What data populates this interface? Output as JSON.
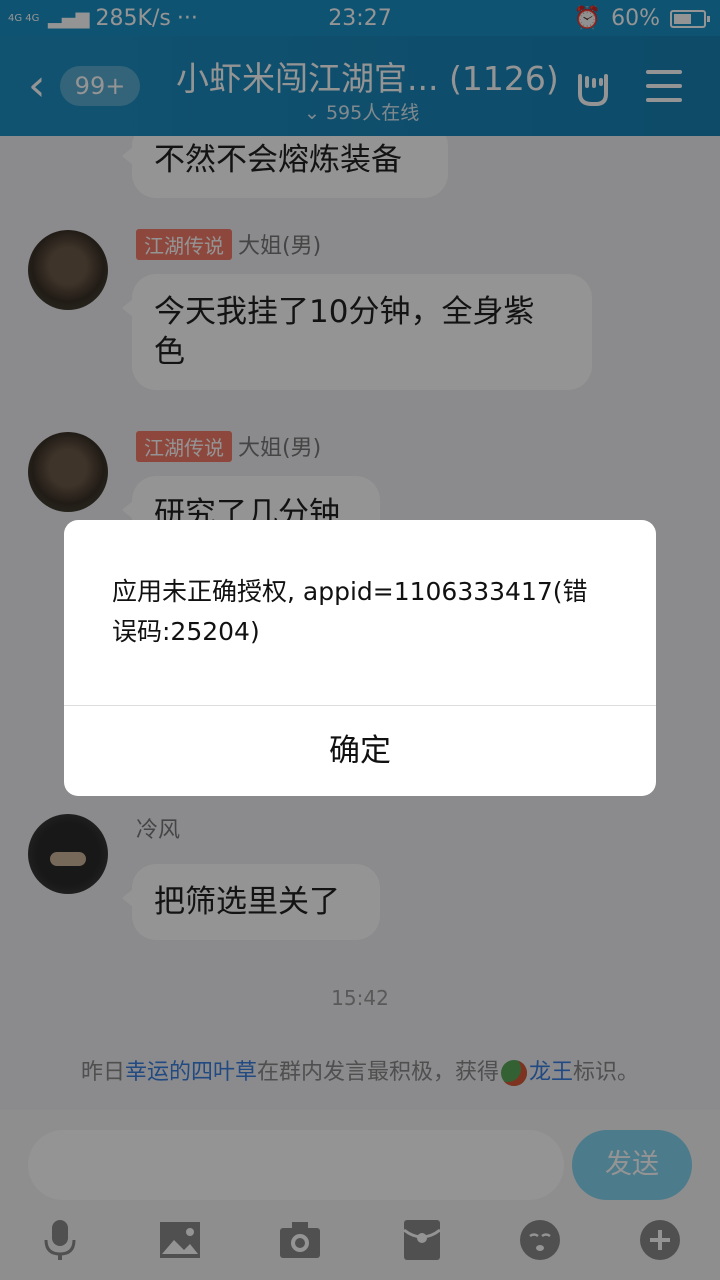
{
  "status": {
    "network": "4G 4G",
    "speed": "285K/s",
    "dots": "···",
    "time": "23:27",
    "battery": "60%",
    "battery_level": 0.6
  },
  "header": {
    "back_badge": "99+",
    "title": "小虾米闯江湖官...",
    "member_count": "(1126)",
    "online": "595人在线"
  },
  "messages": [
    {
      "text": "不然不会熔炼装备"
    },
    {
      "tag": "江湖传说",
      "name": "大姐(男)",
      "text_line1": "今天我挂了10分钟，全身紫",
      "text_line2": "色"
    },
    {
      "tag": "江湖传说",
      "name": "大姐(男)",
      "text": "研究了几分钟"
    },
    {
      "name": "冷风",
      "text": "把筛选里关了"
    }
  ],
  "timestamp": "15:42",
  "system_notice": {
    "pre": "昨日",
    "user": "幸运的四叶草",
    "mid": "在群内发言最积极，获得",
    "badge": "龙王",
    "post": "标识。"
  },
  "input": {
    "send": "发送"
  },
  "dialog": {
    "message": "应用未正确授权, appid=1106333417(错误码:25204)",
    "confirm": "确定"
  },
  "colors": {
    "header": "#1d8fc2",
    "tag": "#f47b6a",
    "link": "#3a7ee0",
    "send": "#84d4f0"
  }
}
